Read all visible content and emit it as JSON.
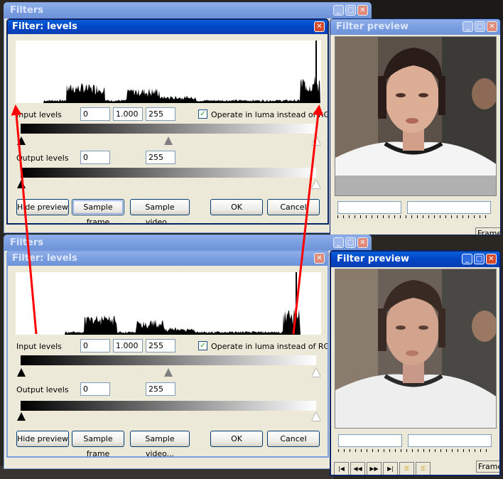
{
  "colors": {
    "titlebar_active": "#0a47c8",
    "titlebar_inactive": "#7a9ee0",
    "window_bg": "#ece9d8",
    "arrow": "#ff0000"
  },
  "top": {
    "filters_title": "Filters",
    "levels_title": "Filter: levels",
    "preview_title": "Filter preview",
    "input_label": "Input levels",
    "input_low": "0",
    "input_gamma": "1.000",
    "input_high": "255",
    "luma_checked": true,
    "luma_label": "Operate in luma instead of RGB",
    "output_label": "Output levels",
    "output_low": "0",
    "output_high": "255",
    "buttons": {
      "hide_preview": "Hide preview",
      "sample_frame": "Sample frame",
      "sample_video": "Sample video...",
      "ok": "OK",
      "cancel": "Cancel"
    },
    "frame_label": "Frame"
  },
  "bottom": {
    "filters_title": "Filters",
    "levels_title": "Filter: levels",
    "preview_title": "Filter preview",
    "input_label": "Input levels",
    "input_low": "0",
    "input_gamma": "1.000",
    "input_high": "255",
    "luma_checked": true,
    "luma_label": "Operate in luma instead of RGB",
    "output_label": "Output levels",
    "output_low": "0",
    "output_high": "255",
    "buttons": {
      "hide_preview": "Hide preview",
      "sample_frame": "Sample frame",
      "sample_video": "Sample video...",
      "ok": "OK",
      "cancel": "Cancel"
    },
    "frame_label": "Frame",
    "nav_icons": [
      "start-icon",
      "prev-key-icon",
      "next-key-icon",
      "end-icon",
      "key-prev-icon",
      "key-next-icon"
    ]
  },
  "glyphs": {
    "minimize": "_",
    "maximize": "□",
    "close": "✕",
    "check": "✓"
  }
}
